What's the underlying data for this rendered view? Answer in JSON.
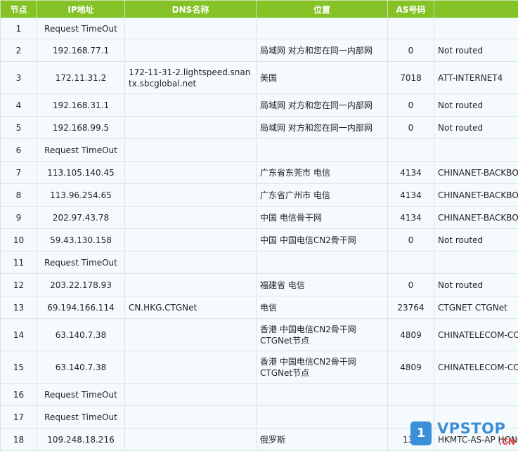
{
  "table": {
    "headers": [
      "节点",
      "IP地址",
      "DNS名称",
      "位置",
      "AS号码",
      ""
    ],
    "rows": [
      {
        "hop": "1",
        "ip": "Request TimeOut",
        "dns": "",
        "loc": "",
        "as": "",
        "net": ""
      },
      {
        "hop": "2",
        "ip": "192.168.77.1",
        "dns": "",
        "loc": "局域网 对方和您在同一内部网",
        "as": "0",
        "net": "Not routed"
      },
      {
        "hop": "3",
        "ip": "172.11.31.2",
        "dns": "172-11-31-2.lightspeed.snantx.sbcglobal.net",
        "loc": "美国",
        "as": "7018",
        "net": "ATT-INTERNET4"
      },
      {
        "hop": "4",
        "ip": "192.168.31.1",
        "dns": "",
        "loc": "局域网 对方和您在同一内部网",
        "as": "0",
        "net": "Not routed"
      },
      {
        "hop": "5",
        "ip": "192.168.99.5",
        "dns": "",
        "loc": "局域网 对方和您在同一内部网",
        "as": "0",
        "net": "Not routed"
      },
      {
        "hop": "6",
        "ip": "Request TimeOut",
        "dns": "",
        "loc": "",
        "as": "",
        "net": ""
      },
      {
        "hop": "7",
        "ip": "113.105.140.45",
        "dns": "",
        "loc": "广东省东莞市 电信",
        "as": "4134",
        "net": "CHINANET-BACKBONE"
      },
      {
        "hop": "8",
        "ip": "113.96.254.65",
        "dns": "",
        "loc": "广东省广州市 电信",
        "as": "4134",
        "net": "CHINANET-BACKBONE"
      },
      {
        "hop": "9",
        "ip": "202.97.43.78",
        "dns": "",
        "loc": "中国 电信骨干网",
        "as": "4134",
        "net": "CHINANET-BACKBONE"
      },
      {
        "hop": "10",
        "ip": "59.43.130.158",
        "dns": "",
        "loc": "中国 中国电信CN2骨干网",
        "as": "0",
        "net": "Not routed"
      },
      {
        "hop": "11",
        "ip": "Request TimeOut",
        "dns": "",
        "loc": "",
        "as": "",
        "net": ""
      },
      {
        "hop": "12",
        "ip": "203.22.178.93",
        "dns": "",
        "loc": "福建省 电信",
        "as": "0",
        "net": "Not routed"
      },
      {
        "hop": "13",
        "ip": "69.194.166.114",
        "dns": "CN.HKG.CTGNet",
        "loc": "电信",
        "as": "23764",
        "net": "CTGNET CTGNet"
      },
      {
        "hop": "14",
        "ip": "63.140.7.38",
        "dns": "",
        "loc": "香港 中国电信CN2骨干网CTGNet节点",
        "as": "4809",
        "net": "CHINATELECOM-CORE Network"
      },
      {
        "hop": "15",
        "ip": "63.140.7.38",
        "dns": "",
        "loc": "香港 中国电信CN2骨干网CTGNet节点",
        "as": "4809",
        "net": "CHINATELECOM-CORE Network"
      },
      {
        "hop": "16",
        "ip": "Request TimeOut",
        "dns": "",
        "loc": "",
        "as": "",
        "net": ""
      },
      {
        "hop": "17",
        "ip": "Request TimeOut",
        "dns": "",
        "loc": "",
        "as": "",
        "net": ""
      },
      {
        "hop": "18",
        "ip": "109.248.18.216",
        "dns": "",
        "loc": "俄罗斯",
        "as": "139",
        "net": "HKMTC-AS-AP HONG"
      }
    ],
    "row_heights": [
      30,
      32,
      46,
      32,
      32,
      32,
      32,
      32,
      32,
      32,
      32,
      32,
      32,
      46,
      46,
      32,
      32,
      32
    ]
  },
  "watermark": {
    "badge": "1",
    "text": "VPSTOP",
    "suffix": ".CN"
  }
}
